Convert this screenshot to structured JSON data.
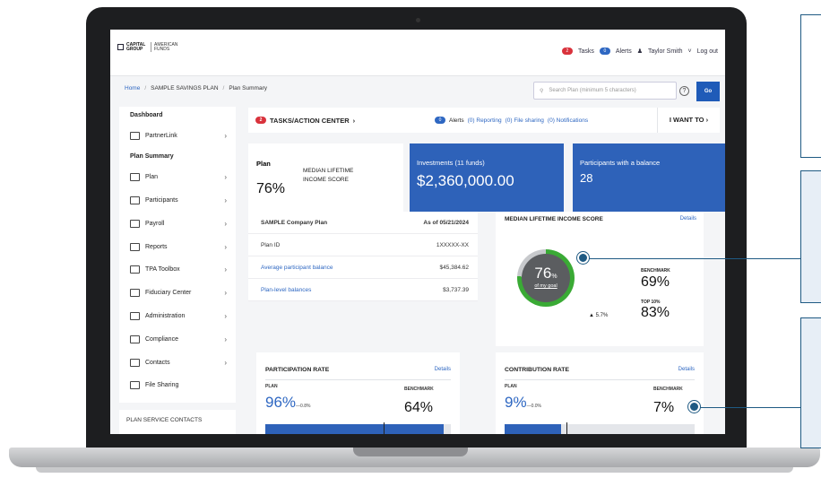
{
  "header": {
    "logo_left": "CAPITAL GROUP",
    "logo_right": "AMERICAN FUNDS",
    "tasks_badge": "2",
    "tasks_label": "Tasks",
    "alerts_badge": "0",
    "alerts_label": "Alerts",
    "user_name": "Taylor Smith",
    "logout": "Log out"
  },
  "breadcrumb": [
    "Home",
    "SAMPLE SAVINGS PLAN",
    "Plan Summary"
  ],
  "search": {
    "placeholder": "Search Plan (minimum 5 characters)",
    "go": "Go",
    "help": "?"
  },
  "sidebar": {
    "dashboard": "Dashboard",
    "partnerlink": "PartnerLink",
    "plan_summary": "Plan Summary",
    "items": [
      {
        "label": "Plan",
        "chev": true
      },
      {
        "label": "Participants",
        "chev": true
      },
      {
        "label": "Payroll",
        "chev": true
      },
      {
        "label": "Reports",
        "chev": true
      },
      {
        "label": "TPA Toolbox",
        "chev": true
      },
      {
        "label": "Fiduciary Center",
        "chev": true
      },
      {
        "label": "Administration",
        "chev": true
      },
      {
        "label": "Compliance",
        "chev": true
      },
      {
        "label": "Contacts",
        "chev": true
      },
      {
        "label": "File Sharing",
        "chev": false
      }
    ],
    "contacts_heading": "PLAN SERVICE CONTACTS"
  },
  "tasks_bar": {
    "badge": "2",
    "title": "TASKS/ACTION CENTER",
    "alerts_badge": "0",
    "alerts": "Alerts",
    "reporting": "(0) Reporting",
    "file_sharing": "(0) File sharing",
    "notifications": "(0) Notifications",
    "i_want_to": "I WANT TO"
  },
  "plan_card": {
    "title": "Plan",
    "pct": "76%",
    "label": "MEDIAN LIFETIME INCOME SCORE"
  },
  "investments_card": {
    "label": "Investments (11 funds)",
    "value": "$2,360,000.00"
  },
  "participants_card": {
    "label": "Participants with a balance",
    "value": "28"
  },
  "plan_details": {
    "plan_name": "SAMPLE Company Plan",
    "as_of": "As of 05/21/2024",
    "rows": [
      {
        "key": "Plan ID",
        "value": "1XXXXX-XX"
      },
      {
        "key": "Average participant balance",
        "value": "$45,384.62"
      },
      {
        "key": "Plan-level balances",
        "value": "$3,737.39"
      }
    ]
  },
  "income_score": {
    "title": "MEDIAN LIFETIME INCOME SCORE",
    "details": "Details",
    "score": "76",
    "score_unit": "%",
    "score_sub": "of my goal",
    "score_fraction": 0.76,
    "benchmark_label": "BENCHMARK",
    "benchmark_value": "69%",
    "top10_label": "TOP 10%",
    "top10_value": "83%",
    "delta": "▲ 5.7%"
  },
  "participation": {
    "title": "PARTICIPATION RATE",
    "details": "Details",
    "plan_label": "PLAN",
    "plan_value": "96%",
    "plan_delta": "—0.8%",
    "benchmark_label": "BENCHMARK",
    "benchmark_value": "64%",
    "plan_fraction": 0.96,
    "benchmark_fraction": 0.64
  },
  "contribution": {
    "title": "CONTRIBUTION RATE",
    "details": "Details",
    "plan_label": "PLAN",
    "plan_value": "9%",
    "plan_delta": "—0.0%",
    "benchmark_label": "BENCHMARK",
    "benchmark_value": "7%",
    "plan_fraction": 0.09,
    "benchmark_fraction": 0.07
  },
  "colors": {
    "brand_blue": "#2e62b9",
    "link_blue": "#2e67c2",
    "alert_red": "#d9323c",
    "score_green": "#3aaa35",
    "callout_navy": "#1f5a83"
  }
}
